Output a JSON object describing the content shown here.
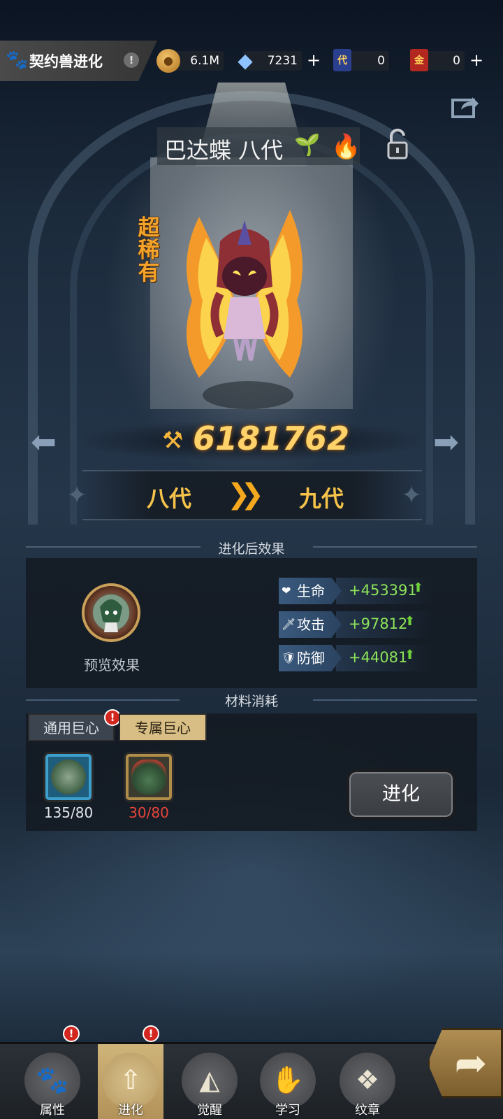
{
  "header": {
    "title": "契约兽进化",
    "info_mark": "!"
  },
  "resources": {
    "coins": "6.1M",
    "crystals": "7231",
    "ticket_blue": "0",
    "ticket_blue_glyph": "代",
    "ticket_red": "0",
    "ticket_red_glyph": "金",
    "plus": "+"
  },
  "beast": {
    "name": "巴达蝶 八代",
    "rarity": "超稀有",
    "power": "6181762"
  },
  "evolution": {
    "from": "八代",
    "to": "九代"
  },
  "effects": {
    "section_title": "进化后效果",
    "preview_label": "预览效果",
    "stats": [
      {
        "label": "生命",
        "value": "+453391",
        "icon": "heart-icon"
      },
      {
        "label": "攻击",
        "value": "+97812",
        "icon": "sword-icon"
      },
      {
        "label": "防御",
        "value": "+44081",
        "icon": "shield-icon"
      }
    ]
  },
  "materials": {
    "section_title": "材料消耗",
    "tabs": [
      {
        "label": "通用巨心",
        "active": false,
        "alert": "!"
      },
      {
        "label": "专属巨心",
        "active": true
      }
    ],
    "items": [
      {
        "count": "135/80",
        "enough": true
      },
      {
        "count": "30/80",
        "enough": false
      }
    ],
    "evolve_button": "进化"
  },
  "bottom_nav": {
    "items": [
      {
        "label": "属性",
        "icon": "paw-icon",
        "alert": "!"
      },
      {
        "label": "进化",
        "icon": "evolve-arrow-icon",
        "alert": "!",
        "active": true
      },
      {
        "label": "觉醒",
        "icon": "fox-mask-icon"
      },
      {
        "label": "学习",
        "icon": "claw-hand-icon"
      },
      {
        "label": "纹章",
        "icon": "emblem-icon"
      }
    ]
  },
  "colors": {
    "power_gold": "#ffd36a",
    "stat_green": "#8ee35a",
    "insufficient_red": "#e6443a",
    "active_tab": "#d8be85"
  }
}
